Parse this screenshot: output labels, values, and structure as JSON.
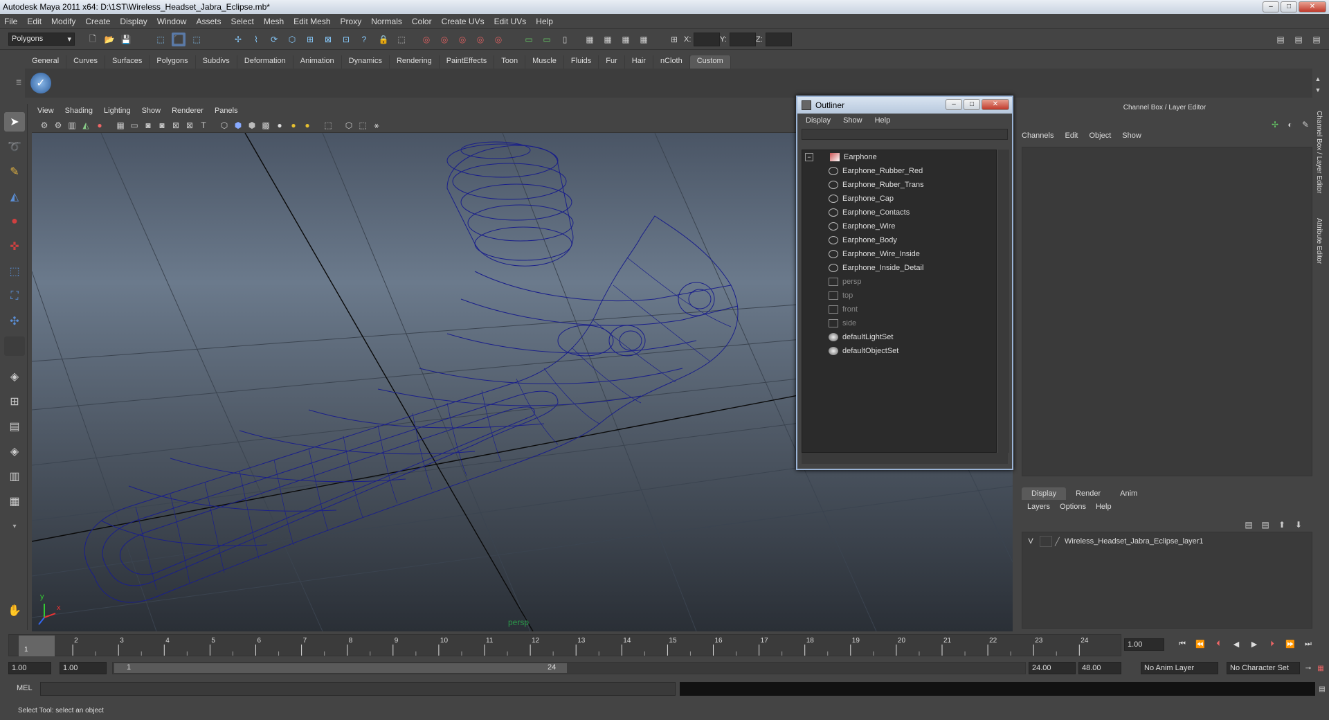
{
  "window": {
    "title": "Autodesk Maya 2011 x64: D:\\1ST\\Wireless_Headset_Jabra_Eclipse.mb*"
  },
  "menubar": [
    "File",
    "Edit",
    "Modify",
    "Create",
    "Display",
    "Window",
    "Assets",
    "Select",
    "Mesh",
    "Edit Mesh",
    "Proxy",
    "Normals",
    "Color",
    "Create UVs",
    "Edit UVs",
    "Help"
  ],
  "status": {
    "mode": "Polygons",
    "x_label": "X:",
    "y_label": "Y:",
    "z_label": "Z:"
  },
  "shelf_tabs": [
    "General",
    "Curves",
    "Surfaces",
    "Polygons",
    "Subdivs",
    "Deformation",
    "Animation",
    "Dynamics",
    "Rendering",
    "PaintEffects",
    "Toon",
    "Muscle",
    "Fluids",
    "Fur",
    "Hair",
    "nCloth",
    "Custom"
  ],
  "shelf_active": "Custom",
  "viewport": {
    "menu": [
      "View",
      "Shading",
      "Lighting",
      "Show",
      "Renderer",
      "Panels"
    ],
    "camera_label": "persp",
    "axis_y": "y",
    "axis_x": "x"
  },
  "outliner": {
    "title": "Outliner",
    "menu": [
      "Display",
      "Show",
      "Help"
    ],
    "root": "Earphone",
    "children": [
      "Earphone_Rubber_Red",
      "Earphone_Ruber_Trans",
      "Earphone_Cap",
      "Earphone_Contacts",
      "Earphone_Wire",
      "Earphone_Body",
      "Earphone_Wire_Inside",
      "Earphone_Inside_Detail"
    ],
    "cameras": [
      "persp",
      "top",
      "front",
      "side"
    ],
    "sets": [
      "defaultLightSet",
      "defaultObjectSet"
    ]
  },
  "channelbox": {
    "title": "Channel Box / Layer Editor",
    "menu": [
      "Channels",
      "Edit",
      "Object",
      "Show"
    ],
    "side_tabs": [
      "Channel Box / Layer Editor",
      "Attribute Editor"
    ]
  },
  "layers": {
    "tabs": [
      "Display",
      "Render",
      "Anim"
    ],
    "active_tab": "Display",
    "menu": [
      "Layers",
      "Options",
      "Help"
    ],
    "rows": [
      {
        "visible": "V",
        "name": "Wireless_Headset_Jabra_Eclipse_layer1"
      }
    ]
  },
  "timeline": {
    "ticks": [
      "1",
      "2",
      "3",
      "4",
      "5",
      "6",
      "7",
      "8",
      "9",
      "10",
      "11",
      "12",
      "13",
      "14",
      "15",
      "16",
      "17",
      "18",
      "19",
      "20",
      "21",
      "22",
      "23",
      "24"
    ],
    "current_frame_label": "1",
    "current_time": "1.00"
  },
  "range": {
    "start": "1.00",
    "playback_start": "1.00",
    "slider_start": "1",
    "slider_end": "24",
    "playback_end": "24.00",
    "end": "48.00",
    "anim_layer": "No Anim Layer",
    "character_set": "No Character Set"
  },
  "command": {
    "label": "MEL"
  },
  "help_line": "Select Tool: select an object",
  "colors": {
    "wire": "#1a1f8a",
    "accent": "#9bb4d6"
  }
}
